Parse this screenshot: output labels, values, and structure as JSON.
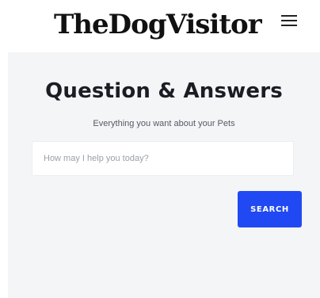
{
  "header": {
    "logo_text": "TheDogVisitor",
    "menu_icon": "hamburger-menu-icon"
  },
  "hero": {
    "title": "Question & Answers",
    "subtitle": "Everything you want about your Pets"
  },
  "search": {
    "placeholder": "How may I help you today?",
    "value": "",
    "button_label": "SEARCH"
  },
  "colors": {
    "accent": "#2149f3",
    "panel_background": "#f4f5f7",
    "title_text": "#1a1d24"
  }
}
